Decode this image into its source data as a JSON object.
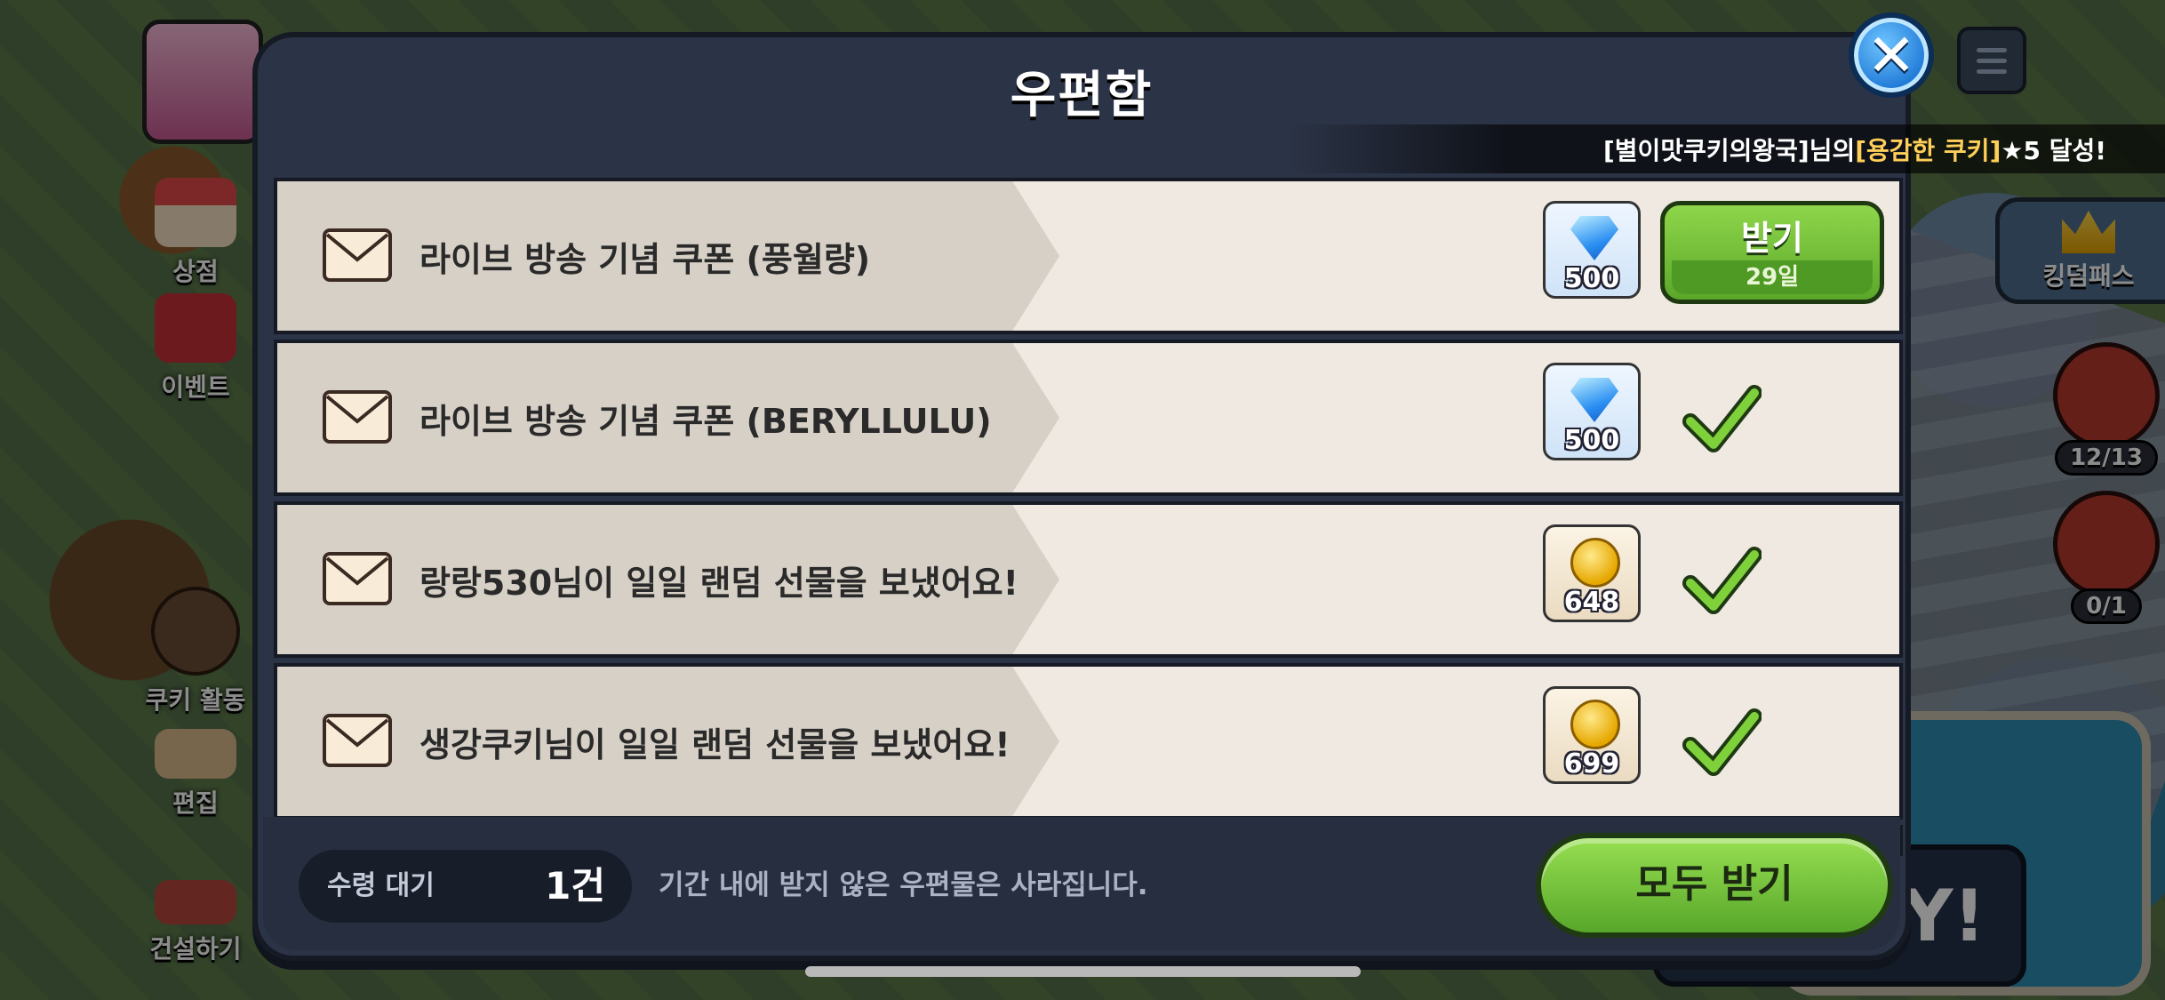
{
  "modal": {
    "title": "우편함",
    "close_icon": "close-icon"
  },
  "banner": {
    "kingdom": "[별이맛쿠키의왕국]",
    "mid": "님의 ",
    "cookie": "[용감한 쿠키]",
    "suffix": " ★5 달성!"
  },
  "sidebar": {
    "items": [
      {
        "label": "상점",
        "icon": "shop-icon"
      },
      {
        "label": "이벤트",
        "icon": "gift-icon"
      },
      {
        "label": "쿠키 활동",
        "icon": "gingerbread-icon"
      },
      {
        "label": "편집",
        "icon": "edit-icon"
      },
      {
        "label": "건설하기",
        "icon": "build-icon"
      }
    ]
  },
  "right_panel": {
    "kingdom_pass": "킹덤패스",
    "house_count": "12/13",
    "battle_count": "0/1",
    "play_peek": "Y!"
  },
  "mail_items": [
    {
      "title": "라이브 방송 기념 쿠폰 (풍월량)",
      "reward_type": "crystal",
      "reward_amount": "500",
      "status": "receive",
      "button_label": "받기",
      "days_left": "29일"
    },
    {
      "title": "라이브 방송 기념 쿠폰 (BERYLLULU)",
      "reward_type": "crystal",
      "reward_amount": "500",
      "status": "received"
    },
    {
      "title": "랑랑530님이 일일 랜덤 선물을 보냈어요!",
      "reward_type": "coin",
      "reward_amount": "648",
      "status": "received"
    },
    {
      "title": "생강쿠키님이 일일 랜덤 선물을 보냈어요!",
      "reward_type": "coin",
      "reward_amount": "699",
      "status": "received"
    }
  ],
  "footer": {
    "pending_label": "수령 대기",
    "pending_count": "1건",
    "notice": "기간 내에 받지 않은 우편물은 사라집니다.",
    "claim_all_label": "모두 받기"
  },
  "colors": {
    "modal_bg": "#2b3346",
    "item_bg": "#efe9e1",
    "accent_green": "#6cbf35",
    "close_blue": "#1f79d6"
  }
}
